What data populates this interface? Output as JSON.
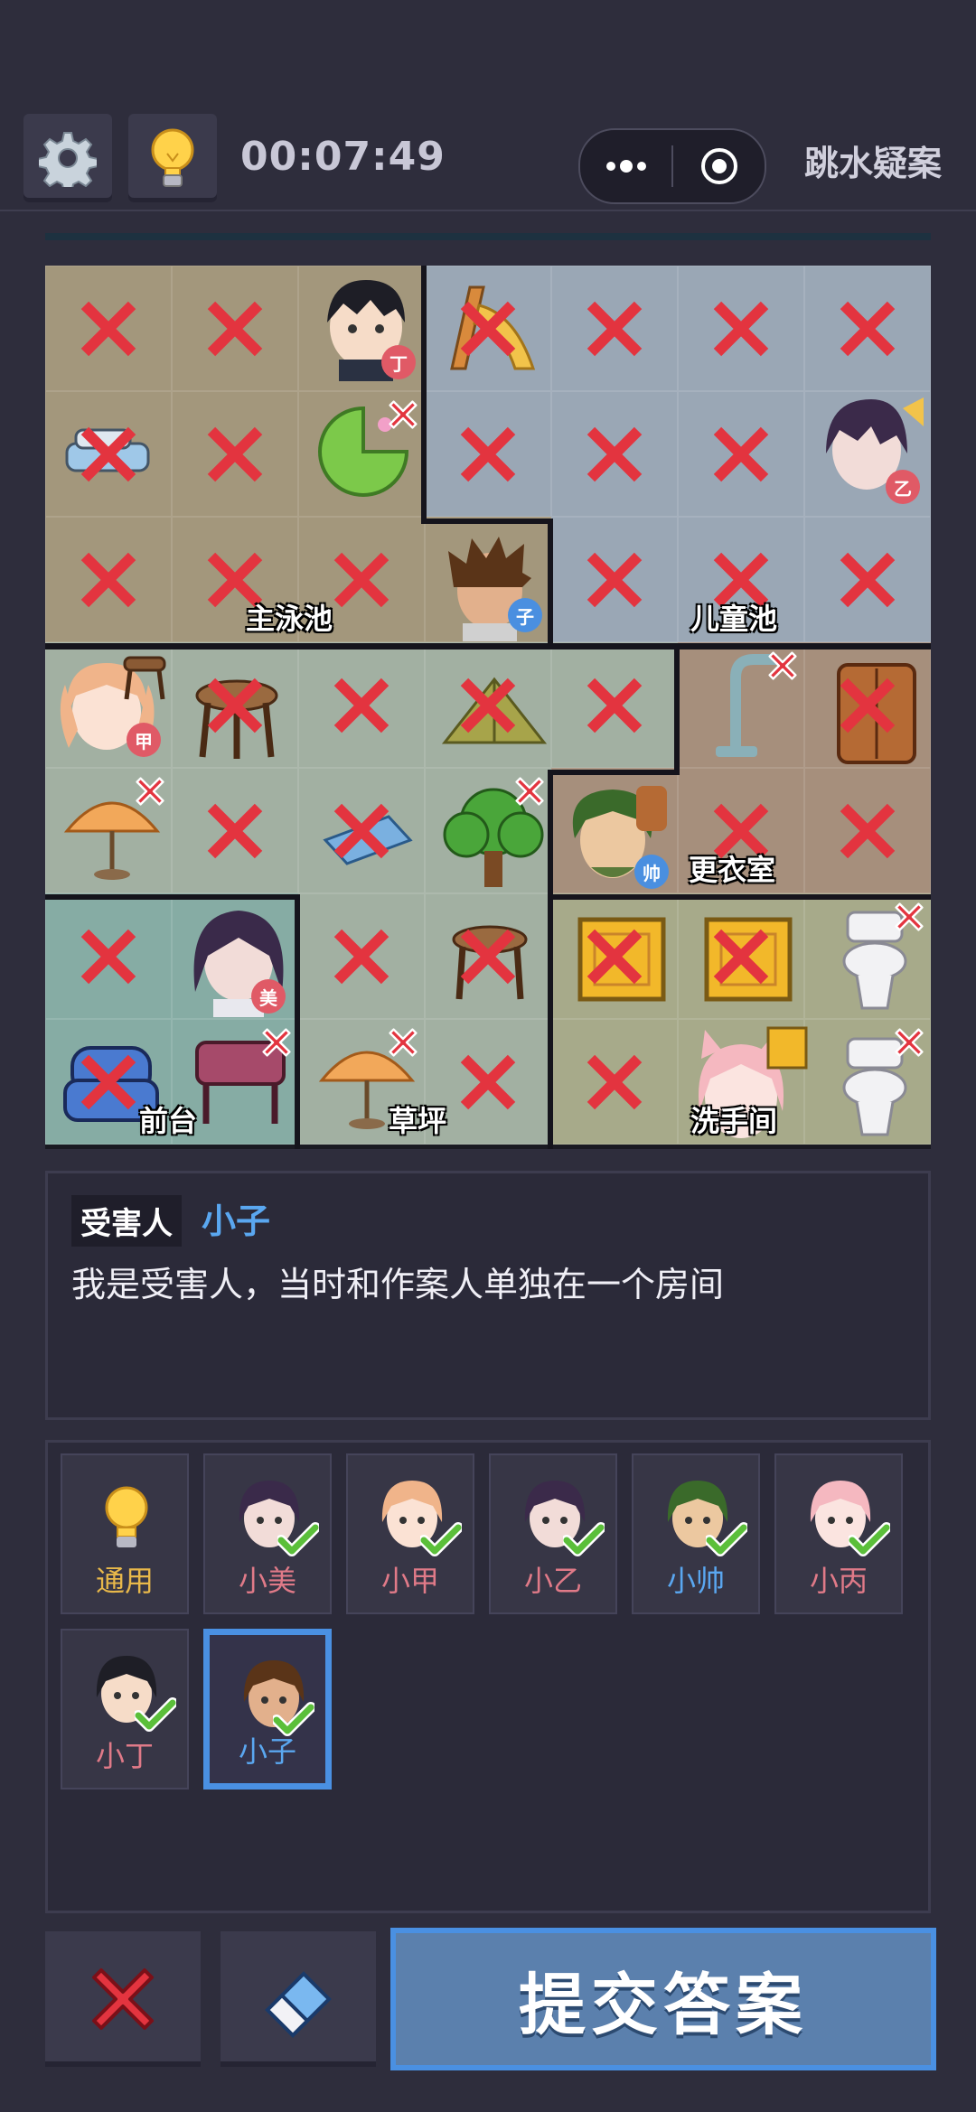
{
  "header": {
    "timer": "00:07:49",
    "app_title": "跳水疑案",
    "settings_icon": "gear-icon",
    "hint_icon": "lightbulb-icon",
    "menu_icon": "more-dots-icon",
    "close_icon": "target-circle-icon"
  },
  "board": {
    "rooms": {
      "main_pool": "主泳池",
      "kids_pool": "儿童池",
      "locker_room": "更衣室",
      "front_desk": "前台",
      "lawn": "草坪",
      "restroom": "洗手间"
    },
    "badges": {
      "ding": "丁",
      "yi": "乙",
      "zi": "子",
      "jia": "甲",
      "shuai": "帅",
      "mei": "美"
    },
    "colors": {
      "main_pool": "#a3977c",
      "kids_pool": "#9aa7b5",
      "lawn": "#a2b0a2",
      "locker_room": "#a68f7c",
      "front_desk": "#86aca4",
      "restroom": "#a7aa8a",
      "x_red": "#e3343f"
    }
  },
  "clue": {
    "tag": "受害人",
    "name": "小子",
    "text": "我是受害人，当时和作案人单独在一个房间"
  },
  "selector": {
    "items": [
      {
        "label": "通用",
        "color": "#e8b84a",
        "icon": "lightbulb-icon"
      },
      {
        "label": "小美",
        "color": "#e07a88"
      },
      {
        "label": "小甲",
        "color": "#e07a88"
      },
      {
        "label": "小乙",
        "color": "#e07a88"
      },
      {
        "label": "小帅",
        "color": "#5aa7f0"
      },
      {
        "label": "小丙",
        "color": "#e07a88"
      },
      {
        "label": "小丁",
        "color": "#e07a88"
      },
      {
        "label": "小子",
        "color": "#5aa7f0"
      }
    ],
    "selected": "小子"
  },
  "footer": {
    "clear_icon": "red-x-icon",
    "eraser_icon": "eraser-icon",
    "submit_label": "提交答案"
  }
}
